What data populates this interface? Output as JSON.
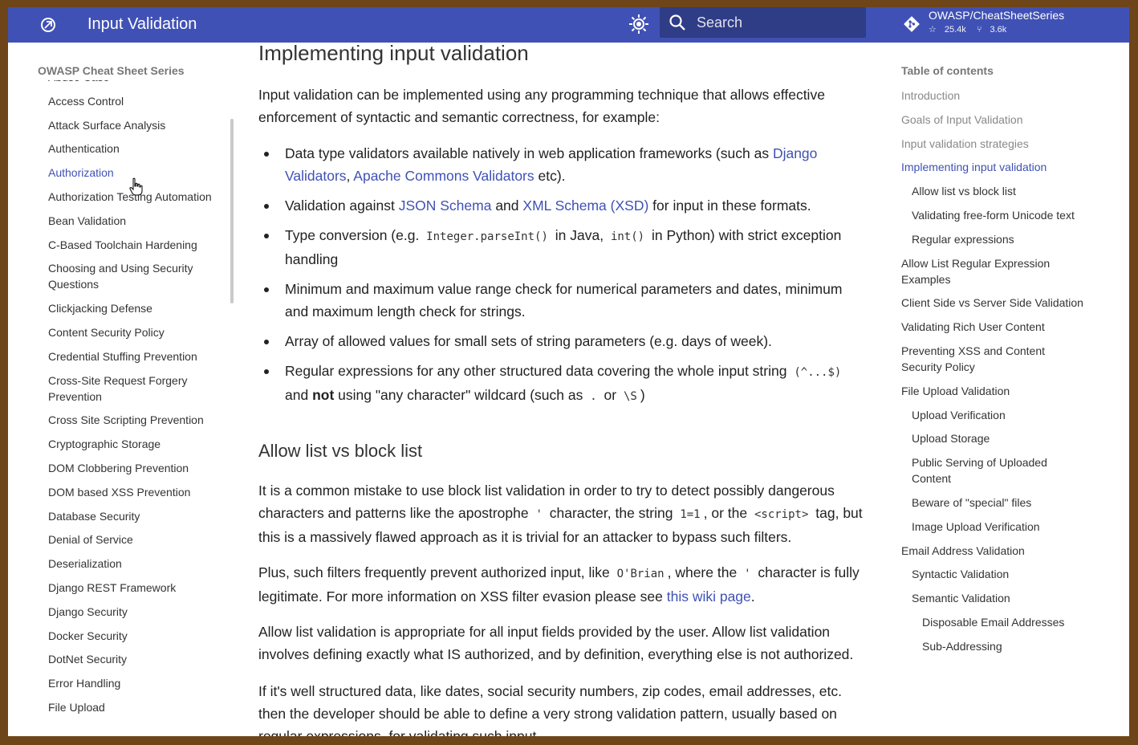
{
  "header": {
    "title": "Input Validation",
    "search_placeholder": "Search",
    "repo": {
      "name": "OWASP/CheatSheetSeries",
      "stars": "25.4k",
      "forks": "3.6k"
    }
  },
  "sidebar": {
    "title": "OWASP Cheat Sheet Series",
    "items": [
      "Abuse Case",
      "Access Control",
      "Attack Surface Analysis",
      "Authentication",
      "Authorization",
      "Authorization Testing Automation",
      "Bean Validation",
      "C-Based Toolchain Hardening",
      "Choosing and Using Security Questions",
      "Clickjacking Defense",
      "Content Security Policy",
      "Credential Stuffing Prevention",
      "Cross-Site Request Forgery Prevention",
      "Cross Site Scripting Prevention",
      "Cryptographic Storage",
      "DOM Clobbering Prevention",
      "DOM based XSS Prevention",
      "Database Security",
      "Denial of Service",
      "Deserialization",
      "Django REST Framework",
      "Django Security",
      "Docker Security",
      "DotNet Security",
      "Error Handling",
      "File Upload"
    ],
    "active_item": "Authorization"
  },
  "main": {
    "h2_implementing": "Implementing input validation",
    "p_intro": "Input validation can be implemented using any programming technique that allows effective enforcement of syntactic and semantic correctness, for example:",
    "b1": {
      "t1": "Data type validators available natively in web application frameworks (such as ",
      "l1": "Django Validators",
      "t2": ", ",
      "l2": "Apache Commons Validators",
      "t3": " etc)."
    },
    "b2": {
      "t1": "Validation against ",
      "l1": "JSON Schema",
      "t2": " and ",
      "l2": "XML Schema (XSD)",
      "t3": " for input in these formats."
    },
    "b3": {
      "t1": "Type conversion (e.g. ",
      "c1": "Integer.parseInt()",
      "t2": " in Java, ",
      "c2": "int()",
      "t3": " in Python) with strict exception handling"
    },
    "b4": "Minimum and maximum value range check for numerical parameters and dates, minimum and maximum length check for strings.",
    "b5": "Array of allowed values for small sets of string parameters (e.g. days of week).",
    "b6": {
      "t1": "Regular expressions for any other structured data covering the whole input string ",
      "c1": "(^...$)",
      "t2": " and ",
      "b": "not",
      "t3": " using \"any character\" wildcard (such as ",
      "c2": ".",
      "t4": " or ",
      "c3": "\\S",
      "t5": ")"
    },
    "h2_allow": "Allow list vs block list",
    "p1": {
      "t1": "It is a common mistake to use block list validation in order to try to detect possibly dangerous characters and patterns like the apostrophe ",
      "c1": "'",
      "t2": " character, the string ",
      "c2": "1=1",
      "t3": ", or the ",
      "c3": "<script>",
      "t4": " tag, but this is a massively flawed approach as it is trivial for an attacker to bypass such filters."
    },
    "p2": {
      "t1": "Plus, such filters frequently prevent authorized input, like ",
      "c1": "O'Brian",
      "t2": ", where the ",
      "c2": "'",
      "t3": " character is fully legitimate. For more information on XSS filter evasion please see ",
      "l1": "this wiki page",
      "t4": "."
    },
    "p3": "Allow list validation is appropriate for all input fields provided by the user. Allow list validation involves defining exactly what IS authorized, and by definition, everything else is not authorized.",
    "p4": "If it's well structured data, like dates, social security numbers, zip codes, email addresses, etc. then the developer should be able to define a very strong validation pattern, usually based on regular expressions, for validating such input."
  },
  "toc": {
    "title": "Table of contents",
    "items": [
      {
        "label": "Introduction",
        "level": 1,
        "state": "muted"
      },
      {
        "label": "Goals of Input Validation",
        "level": 1,
        "state": "muted"
      },
      {
        "label": "Input validation strategies",
        "level": 1,
        "state": "muted"
      },
      {
        "label": "Implementing input validation",
        "level": 1,
        "state": "active"
      },
      {
        "label": "Allow list vs block list",
        "level": 2
      },
      {
        "label": "Validating free-form Unicode text",
        "level": 2
      },
      {
        "label": "Regular expressions",
        "level": 2
      },
      {
        "label": "Allow List Regular Expression Examples",
        "level": 1
      },
      {
        "label": "Client Side vs Server Side Validation",
        "level": 1
      },
      {
        "label": "Validating Rich User Content",
        "level": 1
      },
      {
        "label": "Preventing XSS and Content Security Policy",
        "level": 1
      },
      {
        "label": "File Upload Validation",
        "level": 1
      },
      {
        "label": "Upload Verification",
        "level": 2
      },
      {
        "label": "Upload Storage",
        "level": 2
      },
      {
        "label": "Public Serving of Uploaded Content",
        "level": 2
      },
      {
        "label": "Beware of \"special\" files",
        "level": 2
      },
      {
        "label": "Image Upload Verification",
        "level": 2
      },
      {
        "label": "Email Address Validation",
        "level": 1
      },
      {
        "label": "Syntactic Validation",
        "level": 2
      },
      {
        "label": "Semantic Validation",
        "level": 2
      },
      {
        "label": "Disposable Email Addresses",
        "level": 3
      },
      {
        "label": "Sub-Addressing",
        "level": 3
      }
    ]
  },
  "colors": {
    "header": "#4051b5",
    "link": "#3f51b5",
    "frame": "#6e4519"
  },
  "icons": [
    "logo-icon",
    "palette-toggle-icon",
    "search-icon",
    "git-icon",
    "star-icon",
    "fork-icon",
    "hand-cursor-icon"
  ]
}
